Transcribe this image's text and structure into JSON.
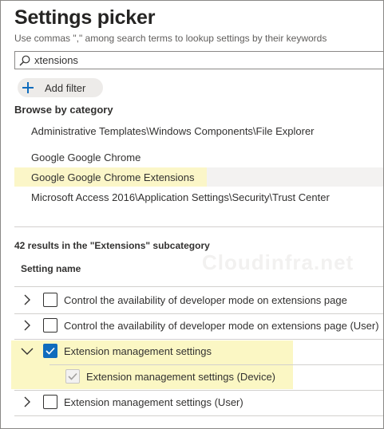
{
  "title": "Settings picker",
  "subtitle": "Use commas \",\" among search terms to lookup settings by their keywords",
  "search": {
    "value": "xtensions",
    "icon": "search-icon"
  },
  "add_filter": {
    "label": "Add filter",
    "icon": "plus-icon"
  },
  "browse_heading": "Browse by category",
  "categories": [
    {
      "label": "Administrative Templates\\Windows Components\\File Explorer",
      "selected": false
    },
    {
      "label": "Google Google Chrome",
      "selected": false
    },
    {
      "label": "Google Google Chrome Extensions",
      "selected": true
    },
    {
      "label": "Microsoft Access 2016\\Application Settings\\Security\\Trust Center",
      "selected": false
    }
  ],
  "results_text": "42 results in the \"Extensions\" subcategory",
  "column_header": "Setting name",
  "watermark": "Cloudinfra.net",
  "settings": [
    {
      "label": "Control the availability of developer mode on extensions page",
      "checked": false,
      "expanded": false
    },
    {
      "label": "Control the availability of developer mode on extensions page (User)",
      "checked": false,
      "expanded": false
    },
    {
      "label": "Extension management settings",
      "checked": true,
      "expanded": true
    },
    {
      "label": "Extension management settings (Device)",
      "checked": true,
      "child": true,
      "disabled": true
    },
    {
      "label": "Extension management settings (User)",
      "checked": false,
      "expanded": false
    }
  ],
  "colors": {
    "accent": "#0f6cbd",
    "highlight": "#fbf6c8",
    "selected_row": "#f3f2f1"
  }
}
